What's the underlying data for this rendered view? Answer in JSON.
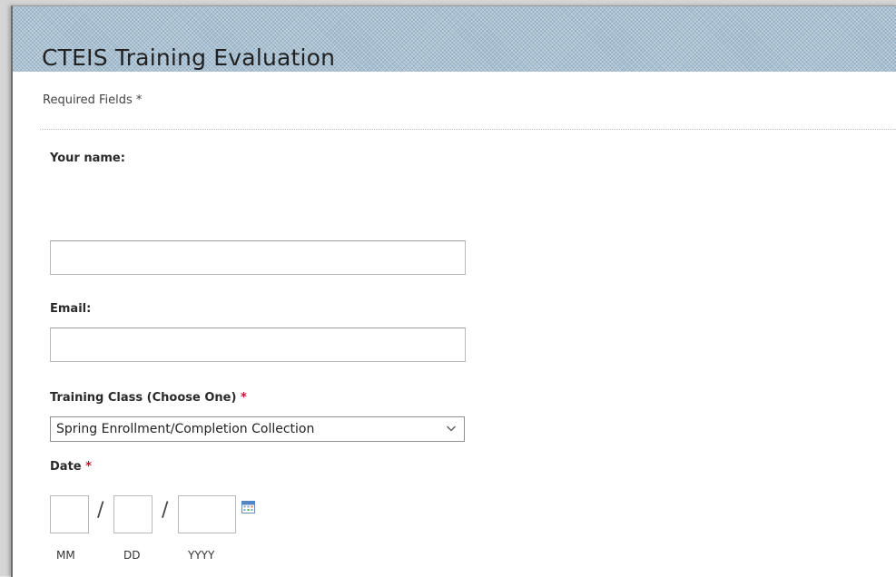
{
  "form": {
    "title": "CTEIS Training Evaluation",
    "required_note": "Required Fields *"
  },
  "fields": {
    "name": {
      "label": "Your name:",
      "value": ""
    },
    "email": {
      "label": "Email:",
      "value": ""
    },
    "training_class": {
      "label": "Training Class (Choose One)",
      "required_marker": "*",
      "selected": "Spring Enrollment/Completion Collection"
    },
    "date": {
      "label": "Date",
      "required_marker": "*",
      "separator": "/",
      "month_caption": "MM",
      "day_caption": "DD",
      "year_caption": "YYYY"
    }
  },
  "icons": {
    "dropdown": "chevron-down-icon",
    "calendar": "calendar-icon"
  },
  "colors": {
    "required": "#c8102e",
    "banner": "#a9c1d3"
  }
}
